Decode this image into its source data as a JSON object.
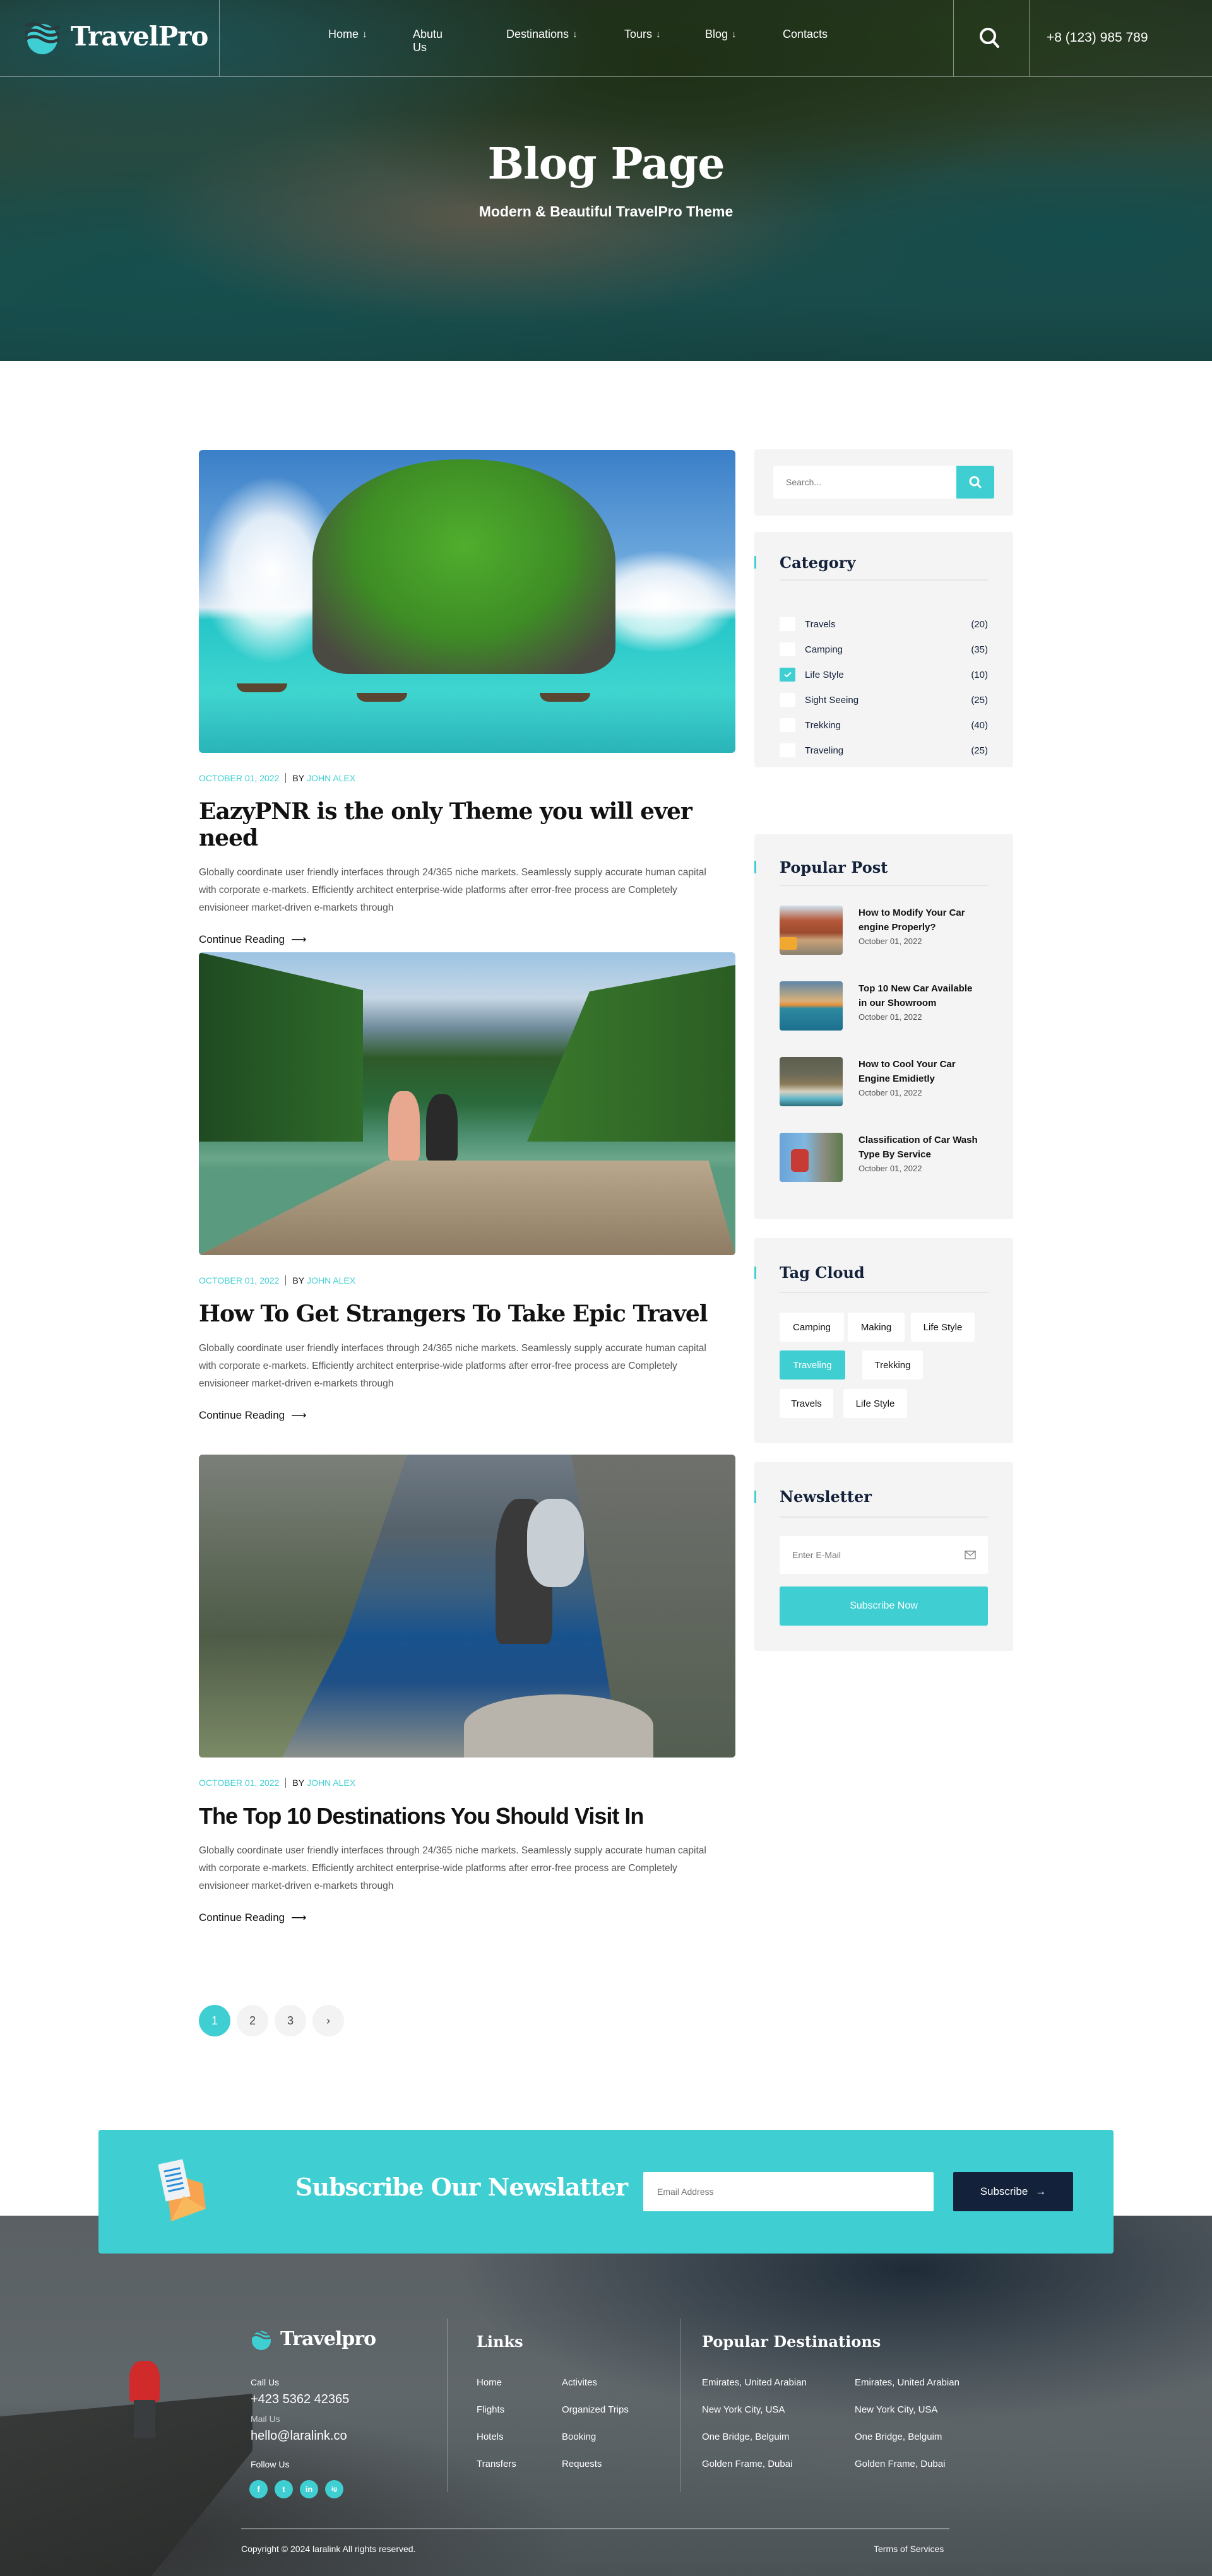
{
  "brand": {
    "name": "TravelPro",
    "accent": "#3fcfd3",
    "navy": "#13213a"
  },
  "nav": {
    "items": [
      {
        "label": "Home",
        "has_dropdown": true
      },
      {
        "label": "Abutu Us",
        "has_dropdown": false
      },
      {
        "label": "Destinations",
        "has_dropdown": true
      },
      {
        "label": "Tours",
        "has_dropdown": true
      },
      {
        "label": "Blog",
        "has_dropdown": true
      },
      {
        "label": "Contacts",
        "has_dropdown": false
      }
    ],
    "dropdown_icon": "↓",
    "phone": "+8 (123) 985 789"
  },
  "hero": {
    "title": "Blog Page",
    "subtitle": "Modern & Beautiful TravelPro Theme"
  },
  "posts": [
    {
      "date": "OCTOBER 01, 2022",
      "by": "BY",
      "author": "JOHN ALEX",
      "title": "EazyPNR is the only Theme you will ever need",
      "excerpt": "Globally coordinate user friendly interfaces through 24/365 niche markets. Seamlessly supply accurate human capital with corporate e-markets. Efficiently architect enterprise-wide platforms after error-free process are Completely envisioneer market-driven e-markets through",
      "cta": "Continue Reading",
      "image": "tropical island with longtail boats"
    },
    {
      "date": "OCTOBER 01, 2022",
      "by": "BY",
      "author": "JOHN ALEX",
      "title": "How To Get Strangers To Take Epic Travel",
      "excerpt": "Globally coordinate user friendly interfaces through 24/365 niche markets. Seamlessly supply accurate human capital with corporate e-markets. Efficiently architect enterprise-wide platforms after error-free process are Completely envisioneer market-driven e-markets through",
      "cta": "Continue Reading",
      "image": "couple on dock by mountain lake"
    },
    {
      "date": "OCTOBER 01, 2022",
      "by": "BY",
      "author": "JOHN ALEX",
      "title": "The Top 10 Destinations You Should Visit In",
      "excerpt": "Globally coordinate user friendly interfaces through 24/365 niche markets. Seamlessly supply accurate human capital with corporate e-markets. Efficiently architect enterprise-wide platforms after error-free process are Completely envisioneer market-driven e-markets through",
      "cta": "Continue Reading",
      "image": "hiker overlooking fjord lake"
    }
  ],
  "sidebar": {
    "search": {
      "placeholder": "Search..."
    },
    "category": {
      "title": "Category",
      "items": [
        {
          "label": "Travels",
          "count": "(20)",
          "checked": false
        },
        {
          "label": "Camping",
          "count": "(35)",
          "checked": false
        },
        {
          "label": "Life Style",
          "count": "(10)",
          "checked": true
        },
        {
          "label": "Sight Seeing",
          "count": "(25)",
          "checked": false
        },
        {
          "label": "Trekking",
          "count": "(40)",
          "checked": false
        },
        {
          "label": "Traveling",
          "count": "(25)",
          "checked": false
        }
      ]
    },
    "popular": {
      "title": "Popular Post",
      "items": [
        {
          "title": "How to Modify Your Car engine Properly?",
          "date": "October 01, 2022"
        },
        {
          "title": "Top 10 New Car Available in our Showroom",
          "date": "October 01, 2022"
        },
        {
          "title": "How to Cool Your Car Engine Emidietly",
          "date": "October 01, 2022"
        },
        {
          "title": "Classification of Car Wash Type By Service",
          "date": "October 01, 2022"
        }
      ]
    },
    "tags": {
      "title": "Tag Cloud",
      "items": [
        {
          "label": "Camping",
          "active": false
        },
        {
          "label": "Making",
          "active": false
        },
        {
          "label": "Life Style",
          "active": false
        },
        {
          "label": "Traveling",
          "active": true
        },
        {
          "label": "Trekking",
          "active": false
        },
        {
          "label": "Travels",
          "active": false
        },
        {
          "label": "Life Style",
          "active": false
        }
      ]
    },
    "newsletter": {
      "title": "Newsletter",
      "placeholder": "Enter E-Mail",
      "button": "Subscribe Now"
    }
  },
  "pagination": {
    "pages": [
      "1",
      "2",
      "3"
    ],
    "current": "1",
    "next": "›"
  },
  "cta": {
    "title": "Subscribe Our Newslatter",
    "placeholder": "Email Address",
    "button": "Subscribe",
    "button_arrow": "→"
  },
  "footer": {
    "brand": "Travelpro",
    "call_label": "Call Us",
    "phone": "+423 5362 42365",
    "mail_label": "Mail Us",
    "email": "hello@laralink.co",
    "follow_label": "Follow Us",
    "social": [
      "f",
      "t",
      "in",
      "ig"
    ],
    "links_title": "Links",
    "links_col1": [
      "Home",
      "Flights",
      "Hotels",
      "Transfers"
    ],
    "links_col2": [
      "Activites",
      "Organized Trips",
      "Booking",
      "Requests"
    ],
    "dest_title": "Popular Destinations",
    "dest_col1": [
      "Emirates, United Arabian",
      "New York City, USA",
      "One Bridge, Belguim",
      "Golden Frame, Dubai"
    ],
    "dest_col2": [
      "Emirates, United Arabian",
      "New York City, USA",
      "One Bridge, Belguim",
      "Golden Frame, Dubai"
    ],
    "copyright": "Copyright © 2024 laralink All rights reserved.",
    "terms": "Terms of Services"
  }
}
